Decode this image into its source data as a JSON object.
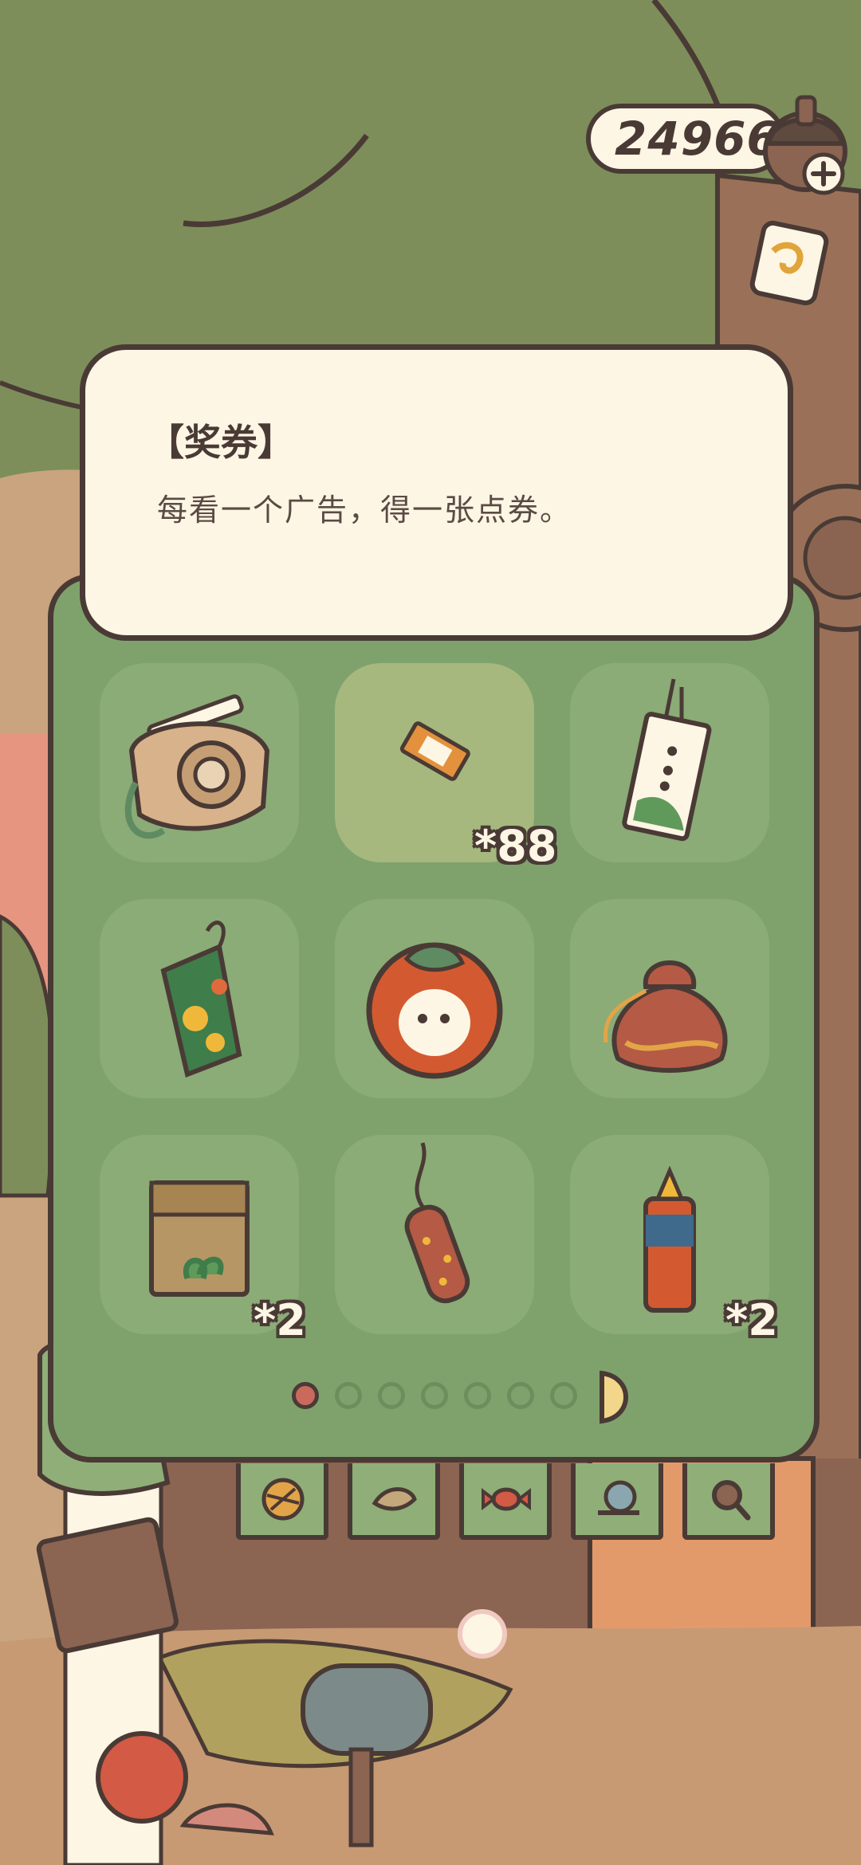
{
  "currency": {
    "value": "24966",
    "icon": "acorn-icon",
    "add_icon": "plus-icon"
  },
  "description": {
    "title": "【奖券】",
    "text": "每看一个广告，得一张点券。"
  },
  "inventory": {
    "items": [
      {
        "name": "camera",
        "icon": "camera-icon",
        "count": ""
      },
      {
        "name": "ticket",
        "icon": "ticket-icon",
        "count": "*88",
        "selected": true
      },
      {
        "name": "omikuji",
        "icon": "omikuji-icon",
        "count": ""
      },
      {
        "name": "flower-bag",
        "icon": "flower-pouch-icon",
        "count": ""
      },
      {
        "name": "apple-bun",
        "icon": "apple-icon",
        "count": ""
      },
      {
        "name": "lucky-bag",
        "icon": "drawstring-bag-icon",
        "count": ""
      },
      {
        "name": "lunch-bag",
        "icon": "paper-bag-icon",
        "count": "*2"
      },
      {
        "name": "firecracker",
        "icon": "firecracker-icon",
        "count": ""
      },
      {
        "name": "lantern",
        "icon": "firework-tube-icon",
        "count": "*2"
      }
    ],
    "pages": 7,
    "current_page": 1
  },
  "shop_flags": [
    {
      "icon": "yarn-ball-icon"
    },
    {
      "icon": "leaf-icon"
    },
    {
      "icon": "candy-icon"
    },
    {
      "icon": "snail-icon"
    },
    {
      "icon": "magnifier-icon"
    }
  ],
  "colors": {
    "panel_green": "#7fa26d",
    "slot_green": "#8bab77",
    "card_cream": "#fdf6e4",
    "outline": "#4a3a35"
  }
}
